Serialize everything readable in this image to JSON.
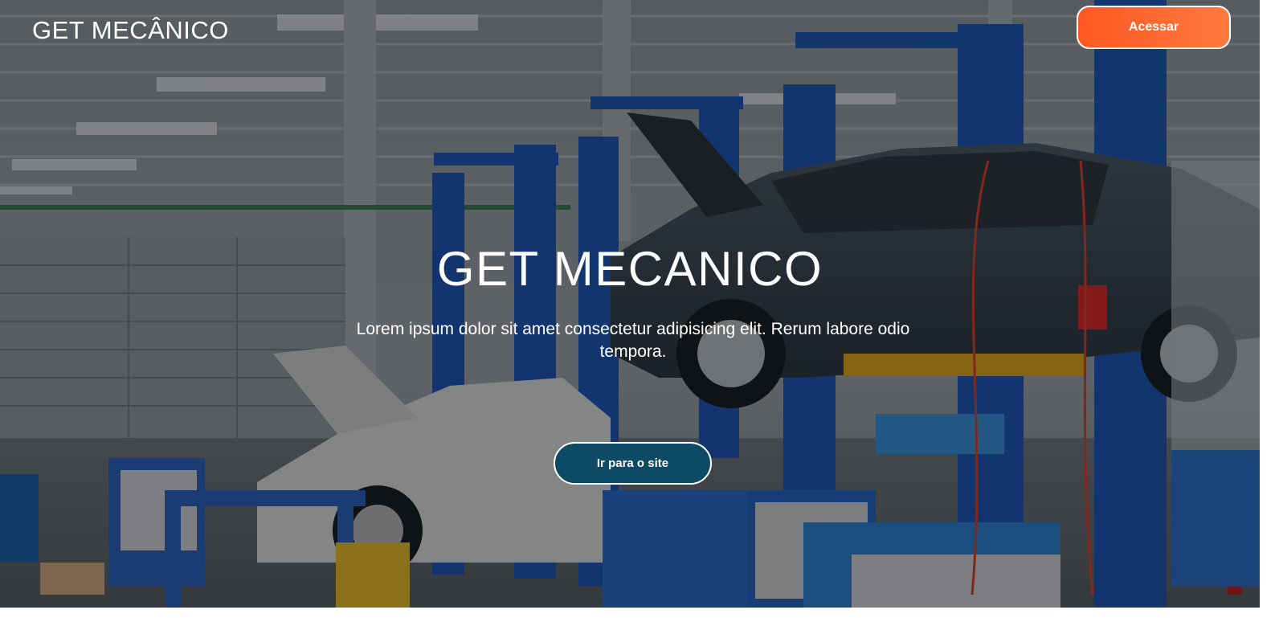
{
  "header": {
    "brand": "GET MECÂNICO",
    "login_label": "Acessar"
  },
  "hero": {
    "title": "GET MECANICO",
    "subtitle": "Lorem ipsum dolor sit amet consectetur adipisicing elit. Rerum labore odio tempora.",
    "cta_label": "Ir para o site",
    "background_image": "auto-repair-garage-with-car-lifts"
  },
  "colors": {
    "login_button": "#ff5722",
    "cta_button": "#0d4a63",
    "lift_blue": "#1f56b3",
    "text": "#ffffff"
  }
}
